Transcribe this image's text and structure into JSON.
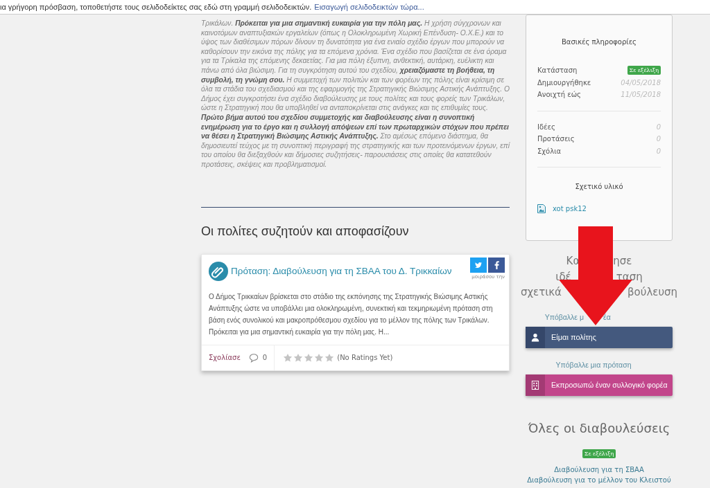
{
  "bookmarks_bar": {
    "message": "ια γρήγορη πρόσβαση, τοποθετήστε τους σελιδοδείκτες σας εδώ στη γραμμή σελιδοδεικτών.",
    "link": "Εισαγωγή σελιδοδεικτών τώρα..."
  },
  "description": "Τρικάλων. **Πρόκειται για μια σημαντική ευκαιρία για την πόλη μας.** Η χρήση σύγχρονων και καινοτόμων αναπτυξιακών εργαλείων (όπως η Ολοκληρωμένη Χωρική Επένδυση- Ο.Χ.Ε.) και το ύψος των διαθέσιμων πόρων δίνουν τη δυνατότητα για ένα ενιαίο σχέδιο έργων που μπορούν να καθορίσουν την εικόνα της πόλης για τα επόμενα χρόνια. Ένα σχέδιο που βασίζεται σε ένα όραμα για τα Τρίκαλα της επόμενης δεκαετίας. Για μια πόλη έξυπνη, ανθεκτική, αυτάρκη, ευέλικτη και πάνω από όλα βιώσιμη. Για τη συγκρότηση αυτού του σχεδίου, **χρειαζόμαστε τη βοήθεια, τη συμβολή, τη γνώμη σου.** Η συμμετοχή των πολιτών και των φορέων της πόλης είναι κρίσιμη σε όλα τα στάδια του σχεδιασμού και της εφαρμογής της Στρατηγικής Βιώσιμης Αστικής Ανάπτυξης. Ο Δήμος έχει συγκροτήσει ένα σχέδιο διαβούλευσης με τους πολίτες και τους φορείς των Τρικάλων, ώστε η Στρατηγική που θα υποβληθεί να ανταποκρίνεται στις ανάγκες και τις επιθυμίες τους. **Πρώτο βήμα αυτού του σχεδίου συμμετοχής και διαβούλευσης είναι η συνοπτική ενημέρωση για το έργο και η συλλογή απόψεων επί των πρωταρχικών στόχων που πρέπει να θέσει η Στρατηγική Βιώσιμης Αστικής Ανάπτυξης.** Στο αμέσως επόμενο διάστημα, θα δημοσιευτεί τεύχος με τη συνοπτική περιγραφή της στρατηγικής και των προτεινόμενων έργων, επί του οποίου θα διεξαχθούν και δήμοσιες συζητήσεις- παρουσιάσεις στις οποίες θα κατατεθούν προτάσεις, σκέψεις και προβληματισμοί.",
  "discussion": {
    "heading": "Οι πολίτες συζητούν και αποφασίζουν",
    "proposals": [
      {
        "title": "Πρόταση: Διαβούλευση για τη ΣΒΑΑ του Δ. Τρικκαίων",
        "share_label": "μοιράσου την",
        "excerpt": "Ο Δήμος Τρικκαίων βρίσκεται στο στάδιο της εκπόνησης της Στρατηγικής Βιώσιμης Αστικής Ανάπτυξης ώστε να υποβάλλει μια ολοκληρωμένη, συνεκτική και τεκμηριωμένη πρόταση στη βάση ενός συνολικού και μακροπρόθεσμου σχεδίου για το μέλλον της πόλης των Τρικάλων. Πρόκειται για μια σημαντική ευκαιρία για την πόλη μας. Η...",
        "comment_link": "Σχολίασε",
        "comment_count": "0",
        "stars": 0,
        "rating_text": "(No Ratings Yet)"
      }
    ]
  },
  "info_card": {
    "title": "Βασικές πληροφορίες",
    "details": [
      {
        "label": "Κατάσταση",
        "kind": "badge",
        "value": "Σε εξέλιξη"
      },
      {
        "label": "Δημιουργήθηκε",
        "kind": "date",
        "value": "04/05/2018"
      },
      {
        "label": "Ανοιχτή εώς",
        "kind": "date",
        "value": "11/05/2018"
      }
    ],
    "counts": [
      {
        "label": "Ιδέες",
        "value": "0"
      },
      {
        "label": "Προτάσεις",
        "value": "0"
      },
      {
        "label": "Σχόλια",
        "value": "0"
      }
    ],
    "materials_title": "Σχετικό υλικό",
    "materials": [
      {
        "name": "xot psk12"
      }
    ]
  },
  "cta": {
    "heading_lines": [
      {
        "left": "Κα",
        "right": "ησε"
      },
      {
        "left": "ιδέ",
        "right": "ταση"
      },
      {
        "left": "σχετικά",
        "right": "βούλευση"
      }
    ],
    "actions": [
      {
        "link_left": "Υπόβαλλε μ",
        "link_right": "έα",
        "button": "Είμαι πολίτης",
        "kind": "citizen"
      },
      {
        "link_left": "Υπόβαλλε μια πρόταση",
        "button": "Εκπροσωπώ έναν συλλογικό φορέα",
        "kind": "organization"
      }
    ]
  },
  "all_consultations": {
    "heading": "Όλες οι διαβουλεύσεις",
    "status_badge": "Σε εξέλιξη",
    "items": [
      "Διαβούλευση για τη ΣΒΑΑ",
      "Διαβούλευση για το μέλλον του Κλειστού"
    ]
  }
}
